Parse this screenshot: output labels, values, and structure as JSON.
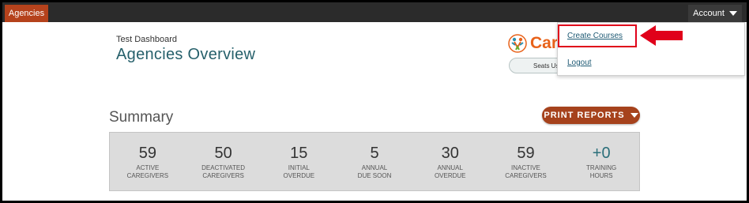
{
  "topbar": {
    "agencies_tab": "Agencies",
    "account_label": "Account"
  },
  "header": {
    "subtitle": "Test Dashboard",
    "title": "Agencies Overview"
  },
  "logo": {
    "text": "Care",
    "seats_text": "Seats Used"
  },
  "account_menu": {
    "items": [
      {
        "label": "Create Courses"
      },
      {
        "label": "Logout"
      }
    ]
  },
  "summary": {
    "title": "Summary",
    "print_button": "PRINT REPORTS",
    "stats": [
      {
        "value": "59",
        "line1": "ACTIVE",
        "line2": "CAREGIVERS"
      },
      {
        "value": "50",
        "line1": "DEACTIVATED",
        "line2": "CAREGIVERS"
      },
      {
        "value": "15",
        "line1": "INITIAL",
        "line2": "OVERDUE"
      },
      {
        "value": "5",
        "line1": "ANNUAL",
        "line2": "DUE SOON"
      },
      {
        "value": "30",
        "line1": "ANNUAL",
        "line2": "OVERDUE"
      },
      {
        "value": "59",
        "line1": "INACTIVE",
        "line2": "CAREGIVERS"
      },
      {
        "value": "+0",
        "line1": "TRAINING",
        "line2": "HOURS"
      }
    ]
  },
  "colors": {
    "brand_orange": "#b5421c",
    "title_teal": "#26606b",
    "highlight_red": "#e0001a"
  }
}
